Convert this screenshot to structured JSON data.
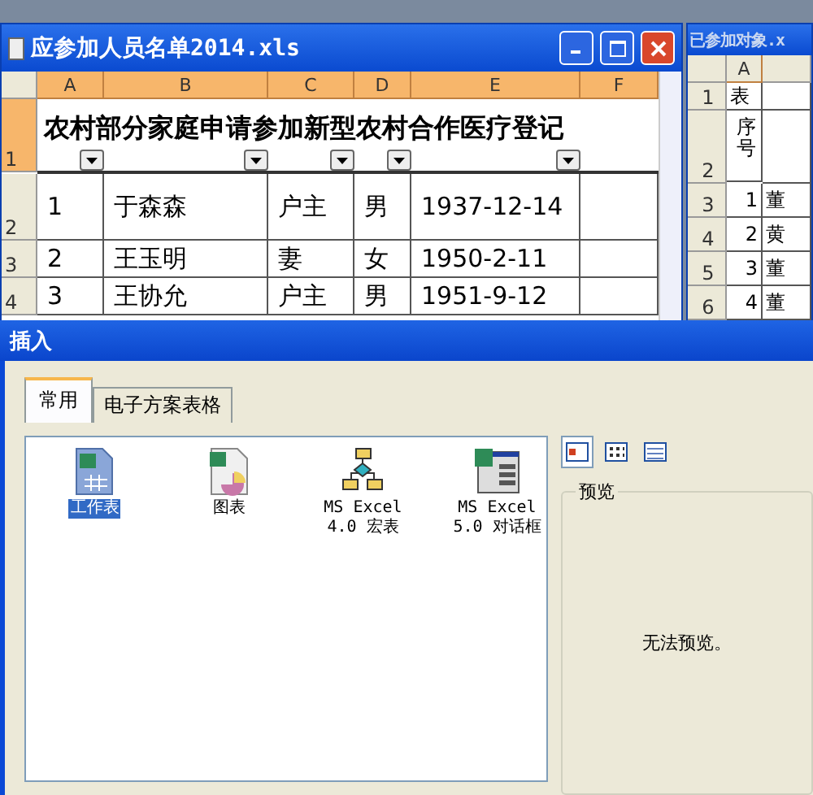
{
  "main_window": {
    "title": "应参加人员名单2014.xls",
    "columns": [
      {
        "letter": "A",
        "filter": true
      },
      {
        "letter": "B",
        "filter": true
      },
      {
        "letter": "C",
        "filter": true
      },
      {
        "letter": "D",
        "filter": true
      },
      {
        "letter": "E",
        "filter": true
      },
      {
        "letter": "F",
        "filter": false
      }
    ],
    "title_row": {
      "row": "1",
      "text": "农村部分家庭申请参加新型农村合作医疗登记"
    },
    "rows": [
      {
        "row": "2",
        "cells": [
          "1",
          "于森森",
          "户主",
          "男",
          "1937-12-14"
        ]
      },
      {
        "row": "3",
        "cells": [
          "2",
          "王玉明",
          "妻",
          "女",
          "1950-2-11"
        ]
      },
      {
        "row": "4",
        "cells": [
          "3",
          "王协允",
          "户主",
          "男",
          "1951-9-12"
        ]
      }
    ]
  },
  "second_window": {
    "title": "已参加对象.x",
    "columns": [
      {
        "letter": "A"
      }
    ],
    "rows": [
      {
        "row": "1",
        "cells": [
          "表"
        ]
      },
      {
        "row": "2",
        "cells": [
          "序号"
        ]
      },
      {
        "row": "3",
        "cells": [
          "1",
          "董"
        ]
      },
      {
        "row": "4",
        "cells": [
          "2",
          "黄"
        ]
      },
      {
        "row": "5",
        "cells": [
          "3",
          "董"
        ]
      },
      {
        "row": "6",
        "cells": [
          "4",
          "董"
        ]
      }
    ]
  },
  "dialog": {
    "title": "插入",
    "tabs": [
      {
        "label": "常用",
        "selected": true
      },
      {
        "label": "电子方案表格",
        "selected": false
      }
    ],
    "items": [
      {
        "kind": "worksheet",
        "label": "工作表",
        "selected": true
      },
      {
        "kind": "chart",
        "label": "图表",
        "selected": false
      },
      {
        "kind": "macro",
        "label": "MS Excel\n4.0 宏表",
        "selected": false
      },
      {
        "kind": "dialog",
        "label": "MS Excel\n5.0 对话框",
        "selected": false
      }
    ],
    "views": [
      {
        "kind": "large",
        "selected": true
      },
      {
        "kind": "small",
        "selected": false
      },
      {
        "kind": "list",
        "selected": false
      }
    ],
    "preview": {
      "legend": "预览",
      "message": "无法预览。"
    }
  }
}
